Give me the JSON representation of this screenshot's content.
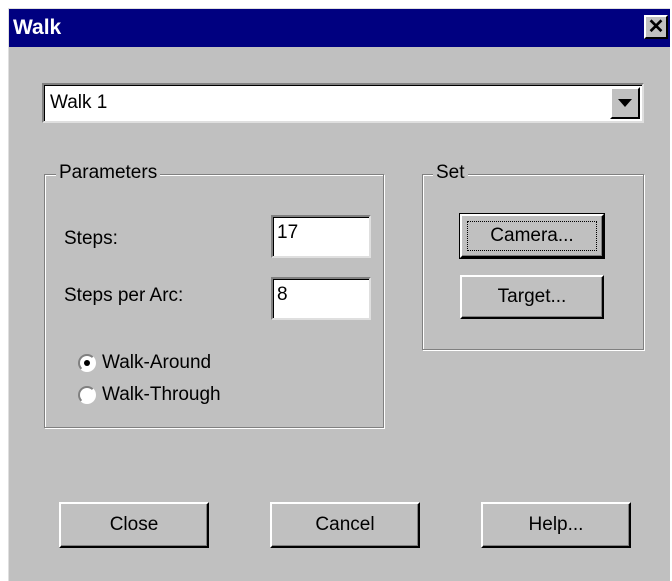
{
  "window": {
    "title": "Walk",
    "close_glyph": "✕"
  },
  "walk_select": {
    "value": "Walk 1"
  },
  "parameters": {
    "legend": "Parameters",
    "steps_label": "Steps:",
    "steps_value": "17",
    "steps_per_arc_label": "Steps per Arc:",
    "steps_per_arc_value": "8",
    "mode_options": [
      {
        "label": "Walk-Around",
        "selected": true
      },
      {
        "label": "Walk-Through",
        "selected": false
      }
    ]
  },
  "set_group": {
    "legend": "Set",
    "camera_label": "Camera...",
    "target_label": "Target..."
  },
  "footer": {
    "close_label": "Close",
    "cancel_label": "Cancel",
    "help_label": "Help..."
  },
  "colors": {
    "titlebar": "#000080",
    "face": "#c0c0c0"
  }
}
